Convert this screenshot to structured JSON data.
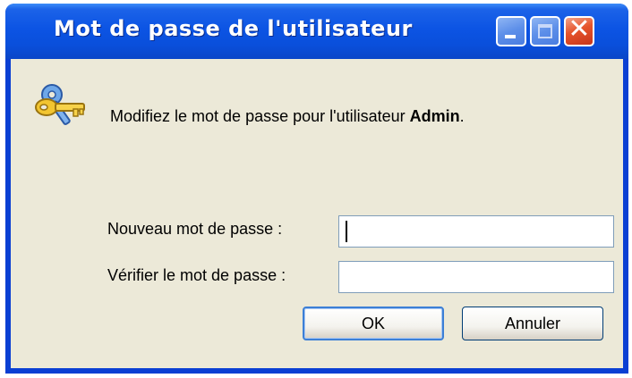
{
  "window": {
    "title": "Mot de passe de l'utilisateur",
    "controls": [
      "minimize-icon",
      "maximize-icon",
      "close-icon"
    ],
    "close_glyph": "✕"
  },
  "message": {
    "prefix": "Modifiez le mot de passe pour l'utilisateur ",
    "username": "Admin",
    "suffix": "."
  },
  "form": {
    "new_password_label": "Nouveau mot de passe :",
    "new_password_value": "",
    "verify_password_label": "Vérifier le mot de passe :",
    "verify_password_value": ""
  },
  "buttons": {
    "ok_label": "OK",
    "cancel_label": "Annuler"
  },
  "colors": {
    "titlebar": "#0a4fdb",
    "client_background": "#ece9d8",
    "close_button": "#e6542b"
  },
  "icon": "keys-icon"
}
